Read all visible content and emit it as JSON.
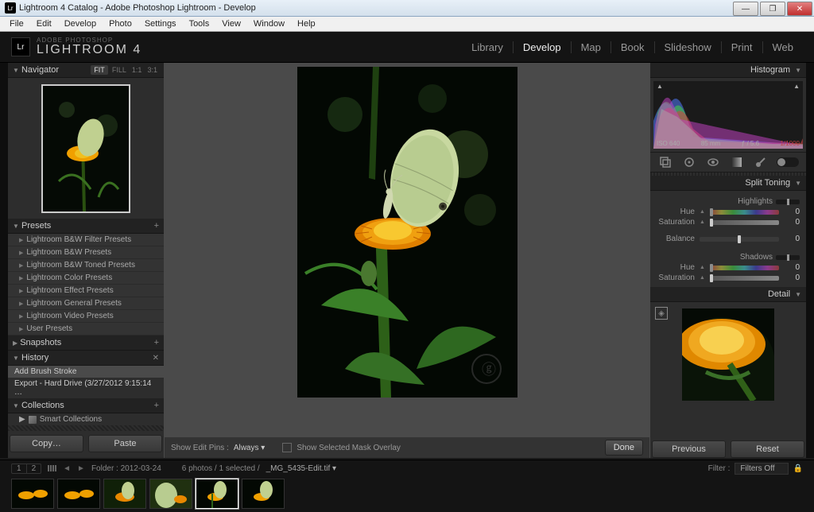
{
  "window": {
    "title": "Lightroom 4 Catalog - Adobe Photoshop Lightroom - Develop"
  },
  "menubar": [
    "File",
    "Edit",
    "Develop",
    "Photo",
    "Settings",
    "Tools",
    "View",
    "Window",
    "Help"
  ],
  "identity": {
    "sub": "ADOBE PHOTOSHOP",
    "main": "LIGHTROOM 4"
  },
  "modules": [
    "Library",
    "Develop",
    "Map",
    "Book",
    "Slideshow",
    "Print",
    "Web"
  ],
  "module_active": "Develop",
  "navigator": {
    "title": "Navigator",
    "modes": [
      "FIT",
      "FILL",
      "1:1",
      "3:1"
    ],
    "mode_active": "FIT"
  },
  "presets": {
    "title": "Presets",
    "items": [
      "Lightroom B&W Filter Presets",
      "Lightroom B&W Presets",
      "Lightroom B&W Toned Presets",
      "Lightroom Color Presets",
      "Lightroom Effect Presets",
      "Lightroom General Presets",
      "Lightroom Video Presets",
      "User Presets"
    ]
  },
  "snapshots": {
    "title": "Snapshots"
  },
  "history": {
    "title": "History",
    "items": [
      "Add Brush Stroke",
      "Export - Hard Drive (3/27/2012 9:15:14 …"
    ],
    "selected_index": 0
  },
  "collections": {
    "title": "Collections",
    "items": [
      "Smart Collections"
    ]
  },
  "left_buttons": {
    "copy": "Copy…",
    "paste": "Paste"
  },
  "center_toolbar": {
    "show_pins_label": "Show Edit Pins :",
    "show_pins_value": "Always",
    "mask_overlay_label": "Show Selected Mask Overlay",
    "done": "Done"
  },
  "right_buttons": {
    "previous": "Previous",
    "reset": "Reset"
  },
  "histogram": {
    "title": "Histogram",
    "iso": "ISO 640",
    "focal": "85 mm",
    "aperture": "ƒ / 5.6",
    "shutter": "1/1000"
  },
  "split_toning": {
    "title": "Split Toning",
    "highlights": "Highlights",
    "shadows": "Shadows",
    "hue": "Hue",
    "saturation": "Saturation",
    "balance": "Balance",
    "values": {
      "h_hue": 0,
      "h_sat": 0,
      "balance": 0,
      "s_hue": 0,
      "s_sat": 0
    }
  },
  "detail": {
    "title": "Detail"
  },
  "filmstrip": {
    "nav": [
      "1",
      "2"
    ],
    "folder_label": "Folder : 2012-03-24",
    "count_label": "6 photos / 1 selected /",
    "filename": "_MG_5435-Edit.tif",
    "filter_label": "Filter :",
    "filter_value": "Filters Off"
  }
}
